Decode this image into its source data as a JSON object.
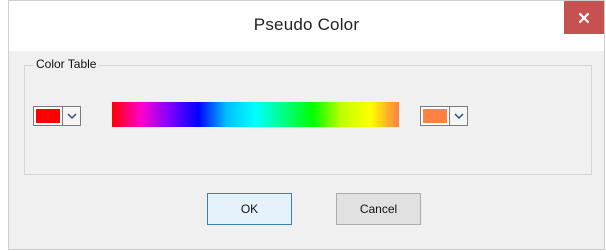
{
  "window": {
    "title": "Pseudo Color"
  },
  "group": {
    "label": "Color Table"
  },
  "start_color": {
    "color": "#ff0000"
  },
  "end_color": {
    "color": "#ff8040"
  },
  "gradient": {
    "stops": [
      "#ff0000",
      "#ff00cc",
      "#8000ff",
      "#0000ff",
      "#00c0ff",
      "#00ffff",
      "#00ff80",
      "#00ff00",
      "#c0ff00",
      "#ffff00",
      "#ff8040"
    ]
  },
  "buttons": {
    "ok": "OK",
    "cancel": "Cancel"
  },
  "icons": {
    "close": "close-icon",
    "dropdown": "chevron-down-icon"
  }
}
